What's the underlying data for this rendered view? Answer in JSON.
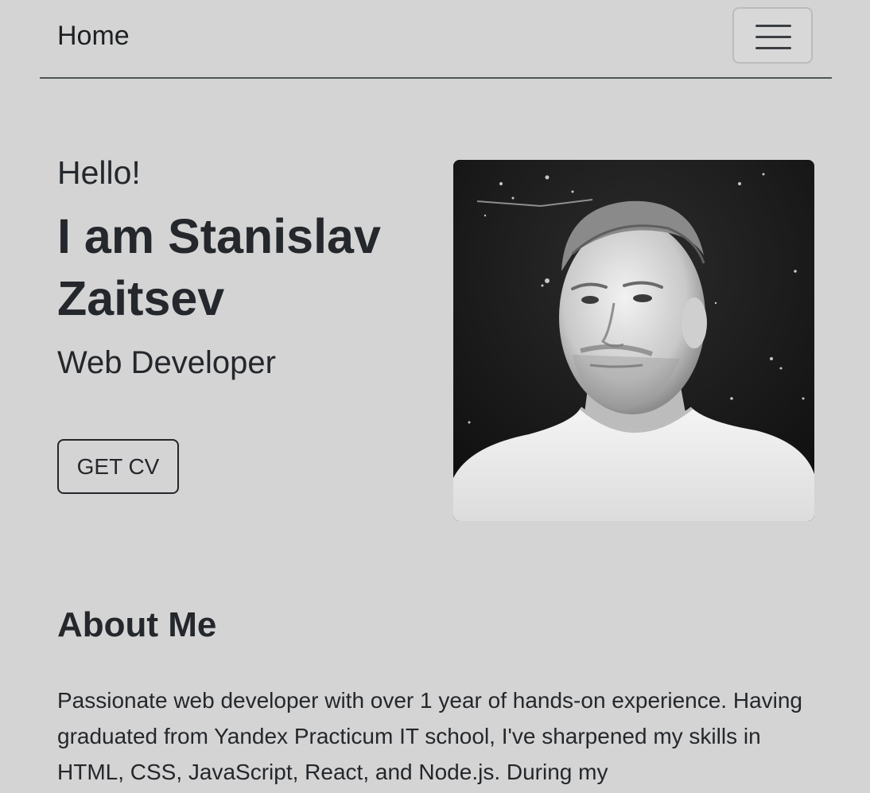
{
  "nav": {
    "brand": "Home",
    "menu_icon": "hamburger-menu-icon"
  },
  "hero": {
    "greeting": "Hello!",
    "name": "I am Stanislav Zaitsev",
    "role": "Web Developer",
    "cv_button": "GET CV"
  },
  "about": {
    "title": "About Me",
    "text": "Passionate web developer with over 1 year of hands-on experience. Having graduated from Yandex Practicum IT school, I've sharpened my skills in HTML, CSS, JavaScript, React, and Node.js. During my"
  },
  "colors": {
    "background": "#d4d4d4",
    "text": "#24272b",
    "nav_border": "#4f5557"
  }
}
